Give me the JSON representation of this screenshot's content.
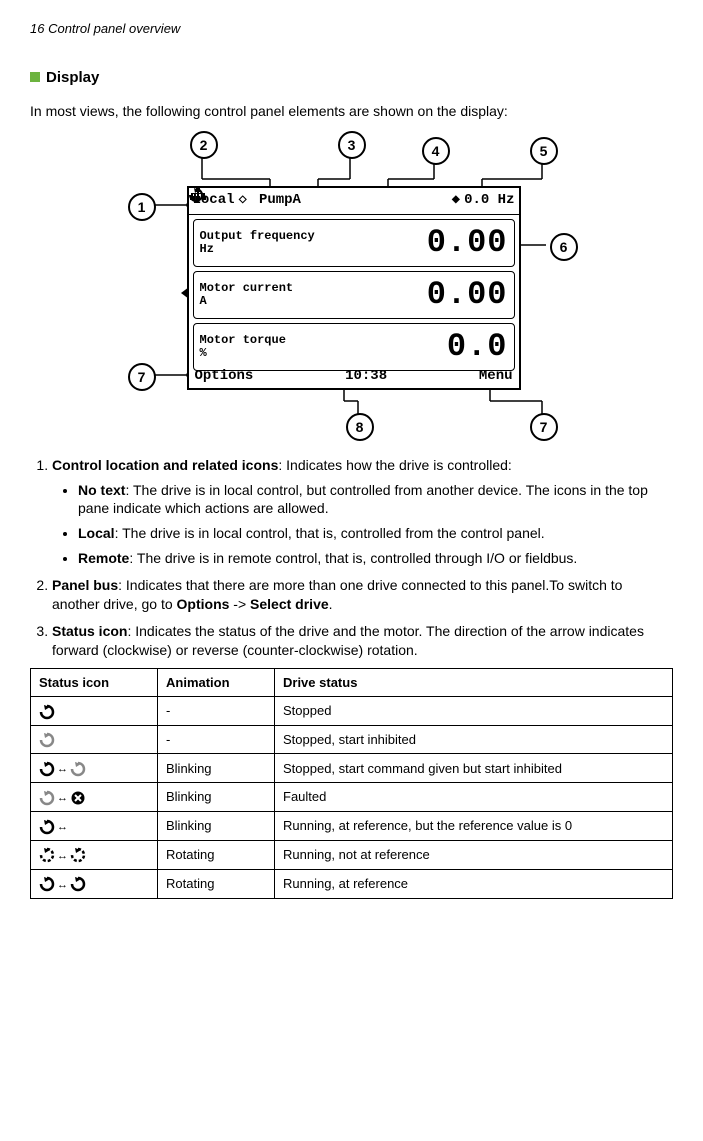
{
  "page_header": "16   Control panel overview",
  "section_title": "Display",
  "intro": "In most views, the following control panel elements are shown on the display:",
  "lcd": {
    "local": "Local",
    "pump": "PumpA",
    "ref": "0.0 Hz",
    "rows": [
      {
        "label1": "Output frequency",
        "label2": "Hz",
        "value": "0.00"
      },
      {
        "label1": "Motor current",
        "label2": "A",
        "value": "0.00"
      },
      {
        "label1": "Motor torque",
        "label2": "%",
        "value": "0.0"
      }
    ],
    "left": "Options",
    "time": "10:38",
    "right": "Menu"
  },
  "callouts": {
    "c1": "1",
    "c2": "2",
    "c3": "3",
    "c4": "4",
    "c5": "5",
    "c6": "6",
    "c7a": "7",
    "c7b": "7",
    "c8": "8"
  },
  "list1": {
    "lead": "Control location and related icons",
    "tail": ": Indicates how the drive is controlled:",
    "a_lead": "No text",
    "a_tail": ": The drive is in local control, but controlled from another device. The icons in the top pane indicate which actions are allowed.",
    "b_lead": "Local",
    "b_tail": ": The drive is in local control, that is, controlled from the control panel.",
    "c_lead": "Remote",
    "c_tail": ": The drive is in remote control, that is, controlled through I/O or fieldbus."
  },
  "list2": {
    "lead": "Panel bus",
    "mid1": ": Indicates that there are more than one drive connected to this panel.To switch to another drive, go to ",
    "opt": "Options",
    "arrow": " -> ",
    "sel": "Select drive",
    "end": "."
  },
  "list3": {
    "lead": "Status icon",
    "tail": ": Indicates the status of the drive and the motor. The direction of the arrow indicates forward (clockwise) or reverse (counter-clockwise) rotation."
  },
  "table": {
    "h1": "Status icon",
    "h2": "Animation",
    "h3": "Drive status",
    "rows": [
      {
        "anim": "-",
        "status": "Stopped"
      },
      {
        "anim": "-",
        "status": "Stopped, start inhibited"
      },
      {
        "anim": "Blinking",
        "status": "Stopped, start command given but start inhibited"
      },
      {
        "anim": "Blinking",
        "status": "Faulted"
      },
      {
        "anim": "Blinking",
        "status": "Running, at reference, but the reference value is 0"
      },
      {
        "anim": "Rotating",
        "status": "Running, not at reference"
      },
      {
        "anim": "Rotating",
        "status": "Running, at reference"
      }
    ]
  }
}
